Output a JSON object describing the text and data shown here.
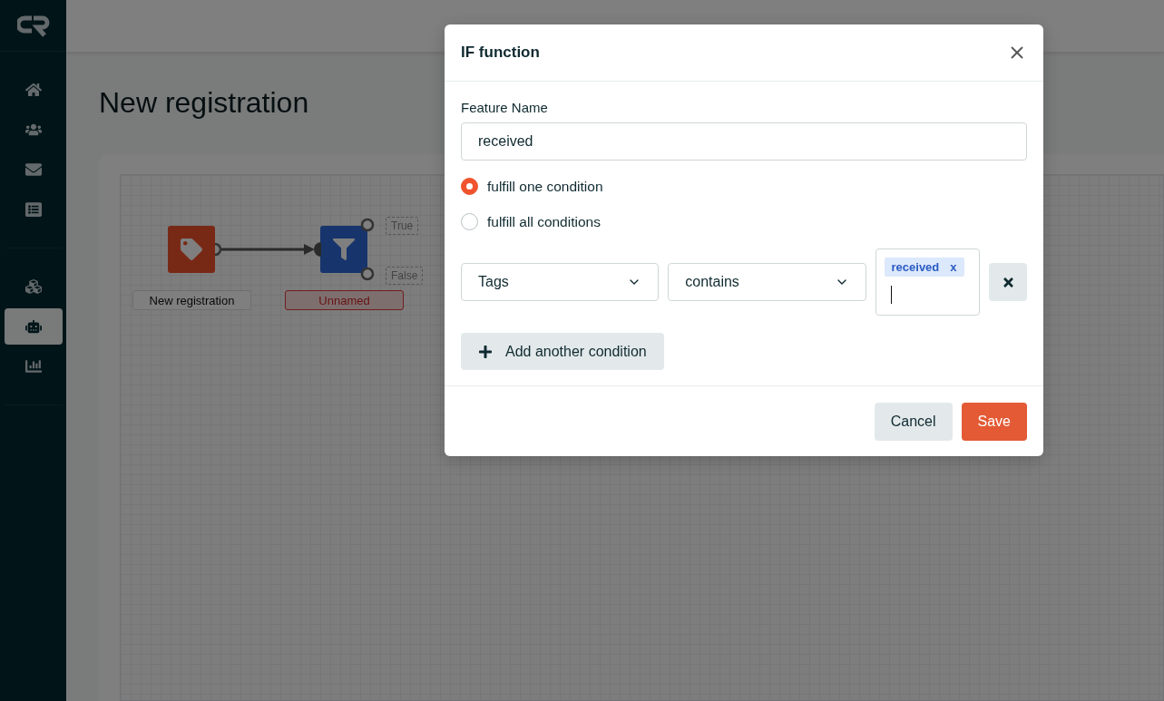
{
  "sidebar": {
    "items": [
      {
        "kind": "home",
        "selected": false
      },
      {
        "kind": "users",
        "selected": false
      },
      {
        "kind": "mail",
        "selected": false
      },
      {
        "kind": "list",
        "selected": false
      },
      {
        "kind": "cubes",
        "selected": false
      },
      {
        "kind": "robot",
        "selected": true
      },
      {
        "kind": "chart",
        "selected": false
      }
    ]
  },
  "page": {
    "title": "New registration"
  },
  "flow": {
    "nodes": [
      {
        "kind": "trigger",
        "label": "New registration",
        "error": false
      },
      {
        "kind": "condition",
        "label": "Unnamed",
        "error": true,
        "branches": [
          "True",
          "False"
        ]
      }
    ]
  },
  "dialog": {
    "title": "IF function",
    "feature_name": {
      "label": "Feature Name",
      "value": "received"
    },
    "match_options": [
      {
        "label": "fulfill one condition",
        "selected": true
      },
      {
        "label": "fulfill all conditions",
        "selected": false
      }
    ],
    "conditions": [
      {
        "field": "Tags",
        "operator": "contains",
        "values": [
          {
            "label": "received",
            "remove": "x"
          }
        ]
      }
    ],
    "add_button": "Add another condition",
    "cancel": "Cancel",
    "save": "Save"
  }
}
